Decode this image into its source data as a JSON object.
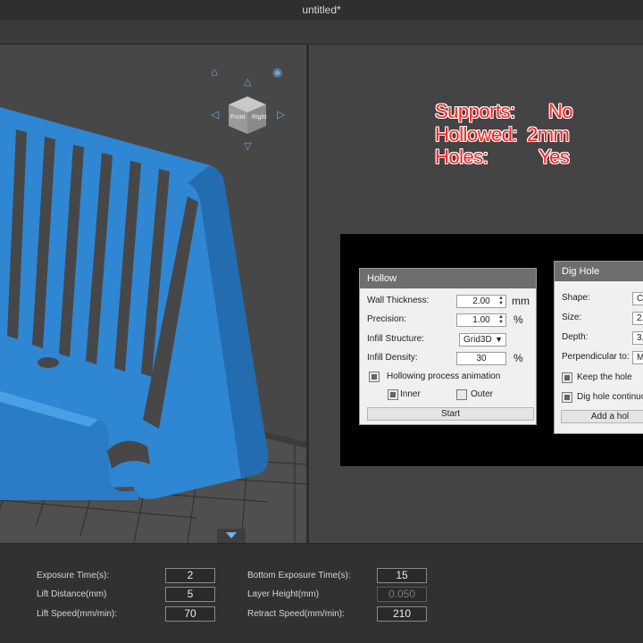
{
  "window": {
    "title": "untitled*"
  },
  "annotation": {
    "supports_label": "Supports:",
    "supports_value": "No",
    "hollowed_label": "Hollowed:",
    "hollowed_value": "2mm",
    "holes_label": "Holes:",
    "holes_value": "Yes"
  },
  "nav_cube": {
    "front": "Front",
    "right": "Right"
  },
  "hollow_dialog": {
    "title": "Hollow",
    "wall_thickness_label": "Wall Thickness:",
    "wall_thickness_value": "2.00",
    "wall_thickness_unit": "mm",
    "precision_label": "Precision:",
    "precision_value": "1.00",
    "precision_unit": "%",
    "infill_structure_label": "Infill Structure:",
    "infill_structure_value": "Grid3D",
    "infill_density_label": "Infill Density:",
    "infill_density_value": "30",
    "infill_density_unit": "%",
    "animation_label": "Hollowing process animation",
    "inner_label": "Inner",
    "outer_label": "Outer",
    "start_label": "Start"
  },
  "dig_dialog": {
    "title": "Dig Hole",
    "shape_label": "Shape:",
    "shape_value": "Ci",
    "size_label": "Size:",
    "size_value": "2.",
    "depth_label": "Depth:",
    "depth_value": "3.",
    "perpendicular_label": "Perpendicular to:",
    "perpendicular_value": "M",
    "keep_hole_label": "Keep the hole",
    "continuous_label": "Dig hole continuou",
    "add_hole_label": "Add a hol"
  },
  "print_params": {
    "exposure_label": "Exposure Time(s):",
    "exposure_value": "2",
    "bottom_exposure_label": "Bottom Exposure Time(s):",
    "bottom_exposure_value": "15",
    "lift_distance_label": "Lift Distance(mm)",
    "lift_distance_value": "5",
    "layer_height_label": "Layer Height(mm)",
    "layer_height_value": "0.050",
    "lift_speed_label": "Lift Speed(mm/min):",
    "lift_speed_value": "70",
    "retract_speed_label": "Retract Speed(mm/min):",
    "retract_speed_value": "210"
  },
  "colors": {
    "model": "#2f86d2",
    "accent": "#6aa8d8",
    "annotation": "#ff1f1f"
  },
  "icons": [
    "home-icon",
    "eye-icon",
    "arrow-up-icon",
    "arrow-down-icon",
    "rotate-left-icon",
    "rotate-right-icon",
    "collapse-arrow-icon"
  ]
}
